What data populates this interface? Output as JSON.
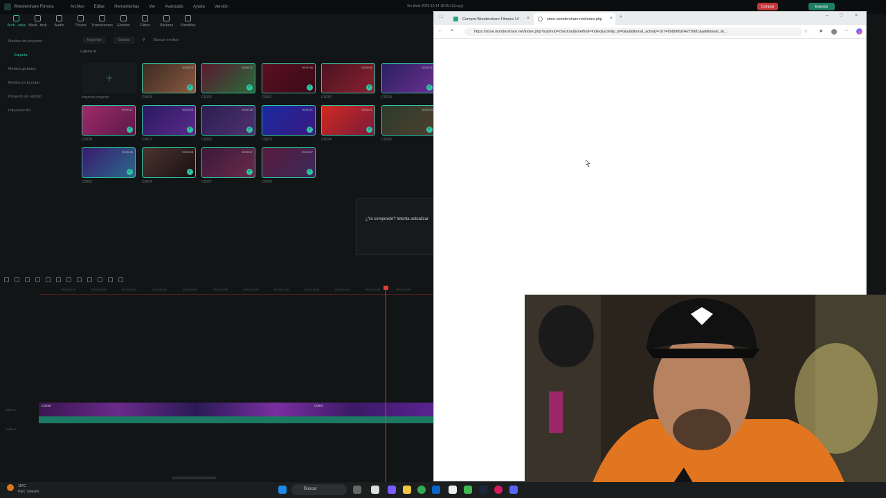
{
  "app": {
    "name": "Wondershare Filmora",
    "menu": [
      "Archivo",
      "Editar",
      "Herramientas",
      "Ver",
      "Avanzado",
      "Ayuda",
      "Versión"
    ],
    "window_title": "Sin título-2025-10-14 18:25:12(copy)",
    "buy_label": "Comprar",
    "export_label": "Exportar",
    "toolbar": [
      "Arch...edia",
      "Medi...tock",
      "Audio",
      "Títulos",
      "Transiciones",
      "Efectos",
      "Filtros",
      "Stickers",
      "Plantillas"
    ],
    "sidebar": [
      "Medios del proyecto",
      "Carpeta",
      "Medios globales",
      "Medios en la nube",
      "Proyecto de edición",
      "Influencer Kit"
    ],
    "media_bar": {
      "import": "Importar",
      "record": "Grabar",
      "search_placeholder": "Buscar medios"
    },
    "folder_label": "CARPETA",
    "import_tile_label": "Importar proyecto",
    "clips": [
      {
        "name": "C0033",
        "dur": "00:00:19"
      },
      {
        "name": "C0032",
        "dur": "00:00:22"
      },
      {
        "name": "C0031",
        "dur": "00:00:46"
      },
      {
        "name": "C0030",
        "dur": "00:00:08"
      },
      {
        "name": "C0029",
        "dur": "00:00:21"
      },
      {
        "name": "C0028",
        "dur": "00:00:17"
      },
      {
        "name": "C0027",
        "dur": "00:00:28"
      },
      {
        "name": "C0026",
        "dur": "00:00:16"
      },
      {
        "name": "C0023",
        "dur": "00:00:21"
      },
      {
        "name": "C0024",
        "dur": "00:00:21"
      },
      {
        "name": "C0035",
        "dur": "00:00:34"
      },
      {
        "name": "C0003",
        "dur": "00:00:43"
      },
      {
        "name": "C0034",
        "dur": "00:00:25"
      },
      {
        "name": "C0037",
        "dur": "00:00:07"
      },
      {
        "name": "C0038",
        "dur": "00:00:07"
      }
    ],
    "dialog_text": "¿Ya compraste? Intenta actualizar",
    "ruler_ticks": [
      "00:00:00:16",
      "00:00:03:00",
      "00:00:03:00",
      "00:00:05:00",
      "00:00:05:00",
      "00:00:10:00",
      "00:00:12:00",
      "00:00:14:00",
      "00:00:16:00",
      "00:00:18:00",
      "00:00:20:00",
      "00:00:22:00"
    ],
    "track_clip_label": "C0038",
    "track_clip_label2": "C0037",
    "video_track": "Video 1",
    "audio_track": "Audio 1"
  },
  "browser": {
    "tabs": [
      {
        "title": "Compra Wondershare Filmora 14"
      },
      {
        "title": "store.wondershare.net/index.php"
      }
    ],
    "url": "https://store.wondershare.net/index.php?submod=checkout&method=index&activity_id=0&additional_activity=1674998966264279081&additional_sk..."
  },
  "taskbar": {
    "temperature": "19°C",
    "condition": "Parc. soleado",
    "search_label": "Buscar"
  },
  "colors": {
    "accent": "#2ec4a5",
    "playhead": "#e43b3b",
    "buy": "#c4373c"
  }
}
